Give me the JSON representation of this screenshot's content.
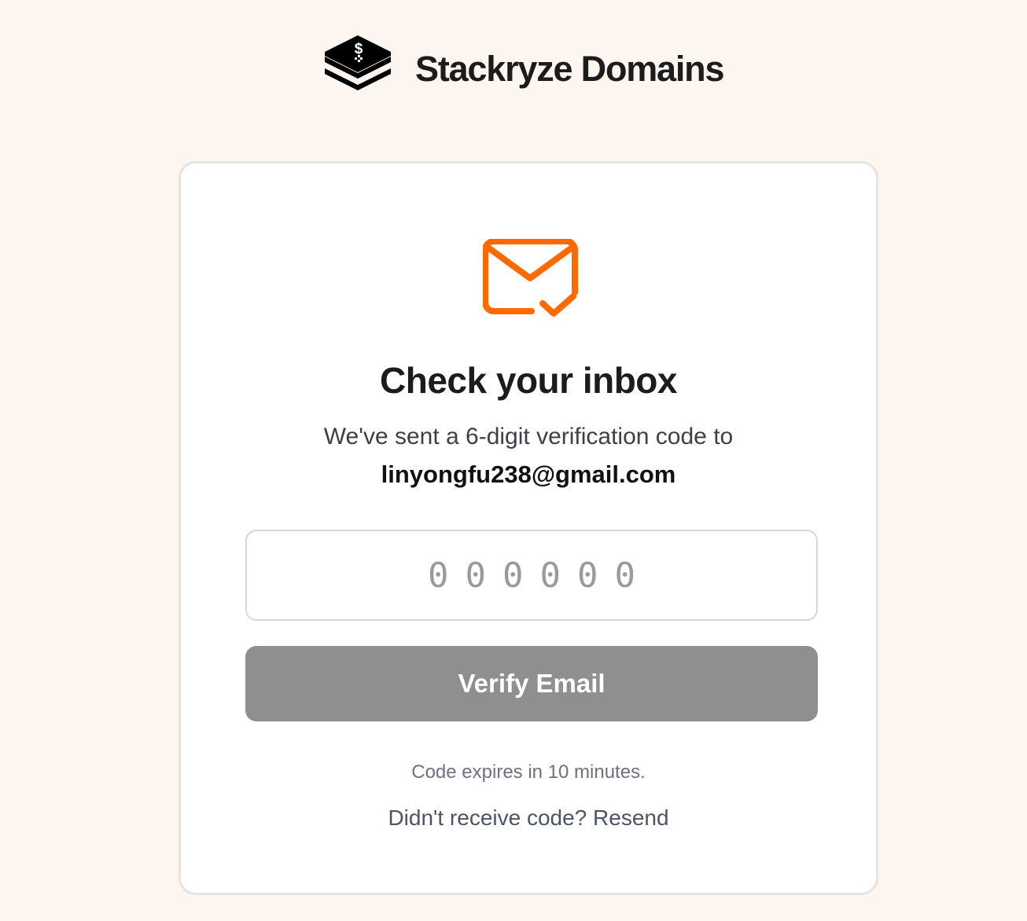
{
  "brand": {
    "name": "Stackryze Domains",
    "logo_icon": "stacked-layers-dollar-icon",
    "logo_glyph": "$"
  },
  "card": {
    "icon": "mail-check-icon",
    "title": "Check your inbox",
    "subtitle": "We've sent a 6-digit verification code to",
    "email": "linyongfu238@gmail.com",
    "code_input": {
      "value": "",
      "placeholder": "000000"
    },
    "verify_button_label": "Verify Email",
    "expiry_note": "Code expires in 10 minutes.",
    "resend_prompt": "Didn't receive code?",
    "resend_link_label": "Resend"
  },
  "colors": {
    "background": "#fdf6f0",
    "accent": "#ff6a00",
    "button_disabled": "#8f8f8f",
    "card_border": "#e7e3df"
  }
}
